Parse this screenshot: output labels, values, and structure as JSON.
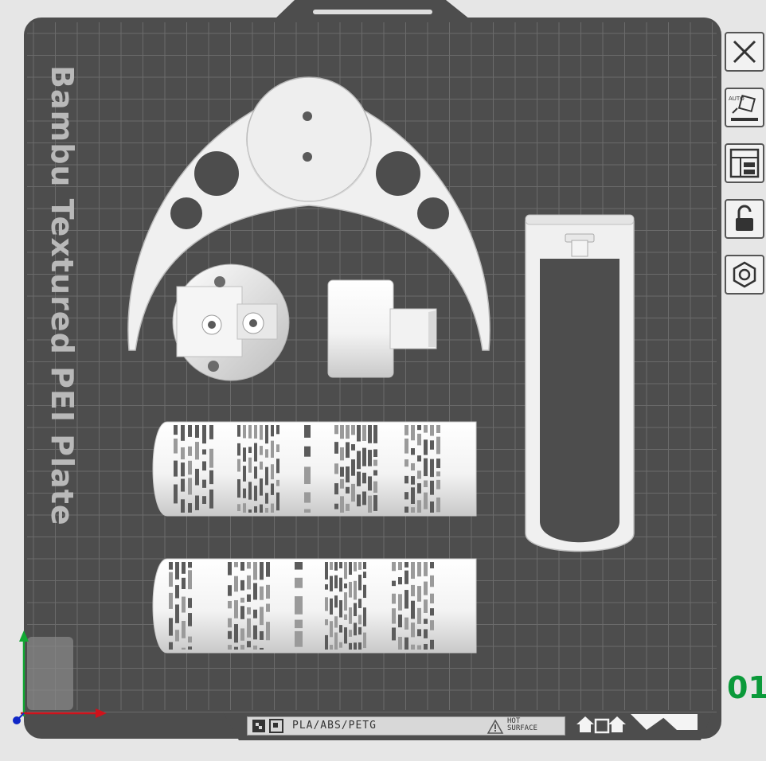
{
  "plate": {
    "name": "Bambu Textured PEI Plate",
    "number": "01",
    "filaments": "PLA/ABS/PETG",
    "warning_line1": "HOT",
    "warning_line2": "SURFACE"
  },
  "toolbar": {
    "items": [
      {
        "id": "close",
        "icon": "close-icon"
      },
      {
        "id": "auto-orient",
        "icon": "auto-orient-icon",
        "badge": "AUTO"
      },
      {
        "id": "arrange",
        "icon": "arrange-icon"
      },
      {
        "id": "lock",
        "icon": "lock-icon"
      },
      {
        "id": "plate-settings",
        "icon": "hex-nut-icon"
      }
    ]
  },
  "colors": {
    "plate": "#4d4d4d",
    "grid": "#6b6b6b",
    "part": "#f0f0f0",
    "axis_x": "#d0121b",
    "axis_y": "#11a833",
    "axis_z": "#1027c7",
    "plate_number": "#0b9a3a"
  }
}
